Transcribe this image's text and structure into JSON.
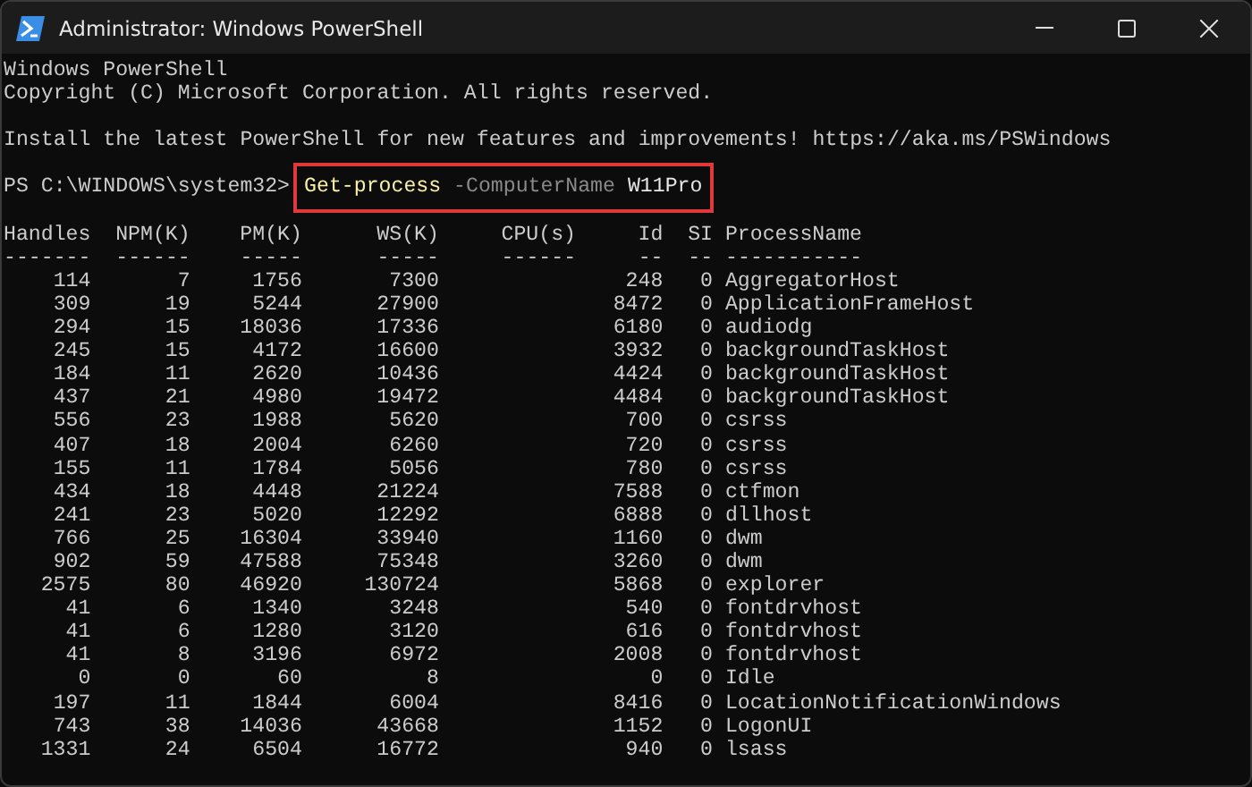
{
  "window": {
    "title": "Administrator: Windows PowerShell"
  },
  "console": {
    "banner": [
      {
        "kind": "text",
        "text": "Windows PowerShell"
      },
      {
        "kind": "text",
        "text": "Copyright (C) Microsoft Corporation. All rights reserved."
      },
      {
        "kind": "blank"
      },
      {
        "kind": "text",
        "text": "Install the latest PowerShell for new features and improvements! https://aka.ms/PSWindows"
      },
      {
        "kind": "blank"
      }
    ],
    "prompt": {
      "text": "PS C:\\WINDOWS\\system32>",
      "highlighted": true,
      "command": [
        {
          "kind": "cmdlet",
          "text": "Get-process"
        },
        {
          "kind": "parameter",
          "text": "-ComputerName"
        },
        {
          "kind": "argument",
          "text": "W11Pro"
        }
      ]
    }
  },
  "table": {
    "columns": [
      {
        "kind": "number",
        "label": "Handles"
      },
      {
        "kind": "number",
        "label": "NPM(K)"
      },
      {
        "kind": "number",
        "label": "PM(K)"
      },
      {
        "kind": "number",
        "label": "WS(K)"
      },
      {
        "kind": "number",
        "label": "CPU(s)"
      },
      {
        "kind": "number",
        "label": "Id"
      },
      {
        "kind": "number",
        "label": "SI"
      },
      {
        "kind": "name",
        "label": "ProcessName"
      }
    ],
    "separator": "-------  ------    -----      -----     ------     --  -- -----------",
    "rows": [
      {
        "cells": [
          "114",
          "7",
          "1756",
          "7300",
          "",
          "248",
          "0",
          "AggregatorHost"
        ]
      },
      {
        "cells": [
          "309",
          "19",
          "5244",
          "27900",
          "",
          "8472",
          "0",
          "ApplicationFrameHost"
        ]
      },
      {
        "cells": [
          "294",
          "15",
          "18036",
          "17336",
          "",
          "6180",
          "0",
          "audiodg"
        ]
      },
      {
        "cells": [
          "245",
          "15",
          "4172",
          "16600",
          "",
          "3932",
          "0",
          "backgroundTaskHost"
        ]
      },
      {
        "cells": [
          "184",
          "11",
          "2620",
          "10436",
          "",
          "4424",
          "0",
          "backgroundTaskHost"
        ]
      },
      {
        "cells": [
          "437",
          "21",
          "4980",
          "19472",
          "",
          "4484",
          "0",
          "backgroundTaskHost"
        ]
      },
      {
        "cells": [
          "556",
          "23",
          "1988",
          "5620",
          "",
          "700",
          "0",
          "csrss"
        ]
      },
      {
        "cells": [
          "407",
          "18",
          "2004",
          "6260",
          "",
          "720",
          "0",
          "csrss"
        ]
      },
      {
        "cells": [
          "155",
          "11",
          "1784",
          "5056",
          "",
          "780",
          "0",
          "csrss"
        ]
      },
      {
        "cells": [
          "434",
          "18",
          "4448",
          "21224",
          "",
          "7588",
          "0",
          "ctfmon"
        ]
      },
      {
        "cells": [
          "241",
          "23",
          "5020",
          "12292",
          "",
          "6888",
          "0",
          "dllhost"
        ]
      },
      {
        "cells": [
          "766",
          "25",
          "16304",
          "33940",
          "",
          "1160",
          "0",
          "dwm"
        ]
      },
      {
        "cells": [
          "902",
          "59",
          "47588",
          "75348",
          "",
          "3260",
          "0",
          "dwm"
        ]
      },
      {
        "cells": [
          "2575",
          "80",
          "46920",
          "130724",
          "",
          "5868",
          "0",
          "explorer"
        ]
      },
      {
        "cells": [
          "41",
          "6",
          "1340",
          "3248",
          "",
          "540",
          "0",
          "fontdrvhost"
        ]
      },
      {
        "cells": [
          "41",
          "6",
          "1280",
          "3120",
          "",
          "616",
          "0",
          "fontdrvhost"
        ]
      },
      {
        "cells": [
          "41",
          "8",
          "3196",
          "6972",
          "",
          "2008",
          "0",
          "fontdrvhost"
        ]
      },
      {
        "cells": [
          "0",
          "0",
          "60",
          "8",
          "",
          "0",
          "0",
          "Idle"
        ]
      },
      {
        "cells": [
          "197",
          "11",
          "1844",
          "6004",
          "",
          "8416",
          "0",
          "LocationNotificationWindows"
        ]
      },
      {
        "cells": [
          "743",
          "38",
          "14036",
          "43668",
          "",
          "1152",
          "0",
          "LogonUI"
        ]
      },
      {
        "cells": [
          "1331",
          "24",
          "6504",
          "16772",
          "",
          "940",
          "0",
          "lsass"
        ]
      }
    ]
  }
}
